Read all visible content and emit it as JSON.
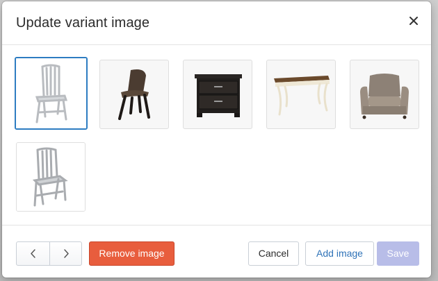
{
  "modal": {
    "title": "Update variant image",
    "close_icon": "close-icon"
  },
  "images": [
    {
      "name": "aluminum-chair-front",
      "selected": true
    },
    {
      "name": "wood-shell-chair",
      "selected": false
    },
    {
      "name": "dark-nightstand",
      "selected": false
    },
    {
      "name": "console-table",
      "selected": false
    },
    {
      "name": "upholstered-armchair",
      "selected": false
    },
    {
      "name": "aluminum-chair-angled",
      "selected": false
    }
  ],
  "footer": {
    "prev_icon": "chevron-left-icon",
    "next_icon": "chevron-right-icon",
    "remove_label": "Remove image",
    "cancel_label": "Cancel",
    "add_label": "Add image",
    "save_label": "Save"
  },
  "colors": {
    "accent": "#2d7cc1",
    "danger": "#e85d3d",
    "save_disabled": "#b8bde8"
  }
}
